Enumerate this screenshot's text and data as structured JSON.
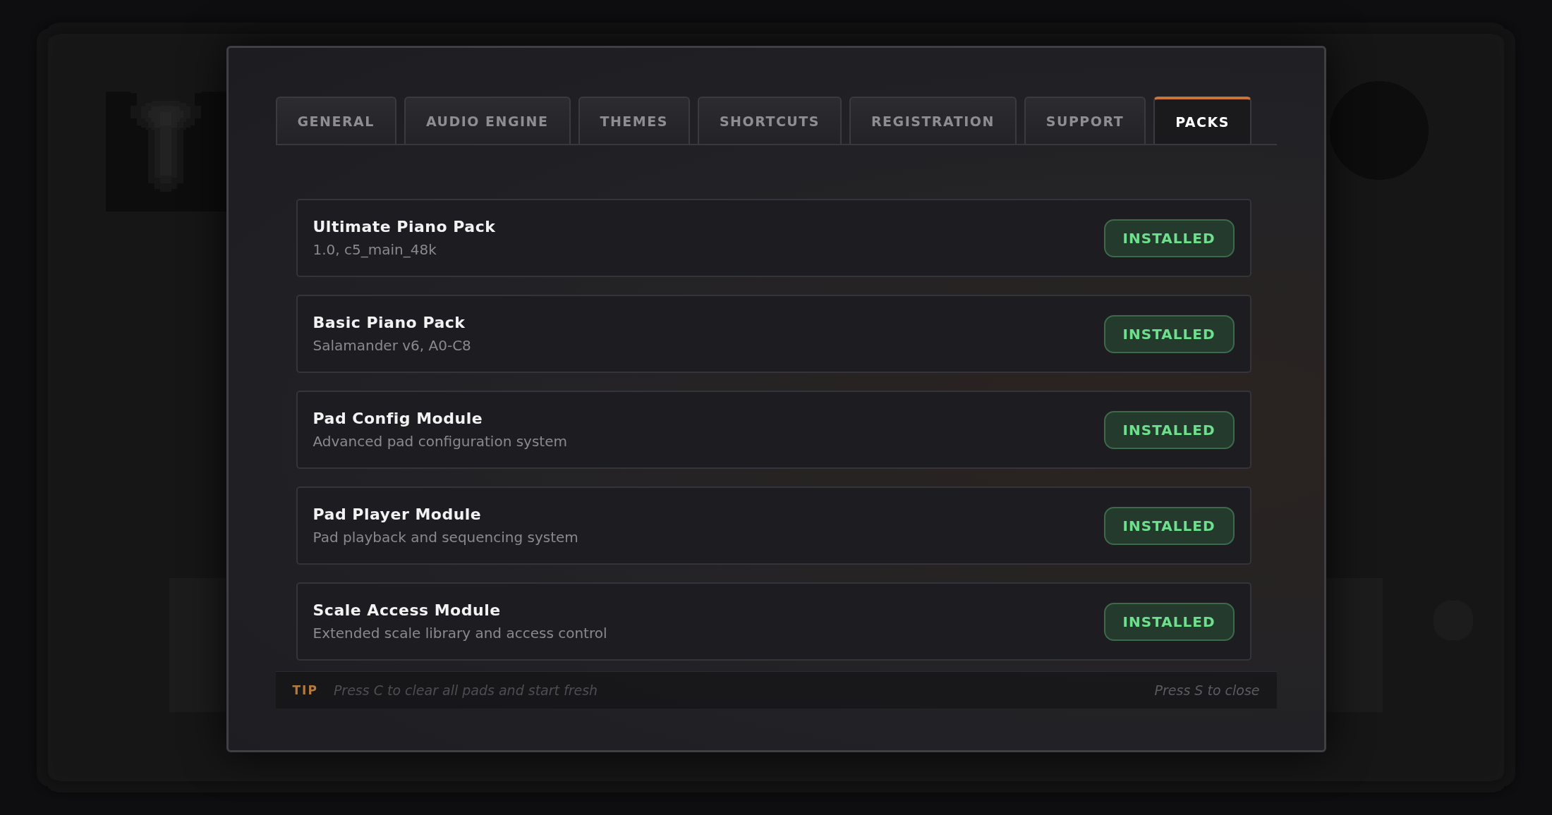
{
  "tabs": [
    {
      "label": "GENERAL",
      "selected": false
    },
    {
      "label": "AUDIO ENGINE",
      "selected": false
    },
    {
      "label": "THEMES",
      "selected": false
    },
    {
      "label": "SHORTCUTS",
      "selected": false
    },
    {
      "label": "REGISTRATION",
      "selected": false
    },
    {
      "label": "SUPPORT",
      "selected": false
    },
    {
      "label": "PACKS",
      "selected": true
    }
  ],
  "packs": [
    {
      "name": "Ultimate Piano Pack",
      "detail": "1.0, c5_main_48k",
      "status": "INSTALLED"
    },
    {
      "name": "Basic Piano Pack",
      "detail": "Salamander v6, A0-C8",
      "status": "INSTALLED"
    },
    {
      "name": "Pad Config Module",
      "detail": "Advanced pad configuration system",
      "status": "INSTALLED"
    },
    {
      "name": "Pad Player Module",
      "detail": "Pad playback and sequencing system",
      "status": "INSTALLED"
    },
    {
      "name": "Scale Access Module",
      "detail": "Extended scale library and access control",
      "status": "INSTALLED"
    }
  ],
  "footer": {
    "tip_label": "TIP",
    "tip": "Press C to clear all pads and start fresh",
    "hint": "Press S to close"
  }
}
